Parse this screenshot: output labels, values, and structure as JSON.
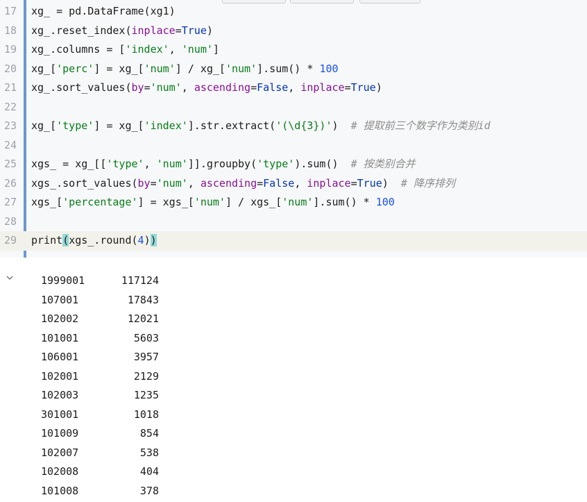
{
  "editor": {
    "lines": [
      {
        "num": "17",
        "tokens": [
          [
            "t",
            "xg_ = pd.DataFrame(xg1)"
          ]
        ]
      },
      {
        "num": "18",
        "tokens": [
          [
            "t",
            "xg_.reset_index("
          ],
          [
            "kw",
            "inplace"
          ],
          [
            "t",
            "="
          ],
          [
            "bool",
            "True"
          ],
          [
            "t",
            ")"
          ]
        ]
      },
      {
        "num": "19",
        "tokens": [
          [
            "t",
            "xg_.columns = ["
          ],
          [
            "str",
            "'index'"
          ],
          [
            "t",
            ", "
          ],
          [
            "str",
            "'num'"
          ],
          [
            "t",
            "]"
          ]
        ]
      },
      {
        "num": "20",
        "tokens": [
          [
            "t",
            "xg_["
          ],
          [
            "str",
            "'perc'"
          ],
          [
            "t",
            "] = xg_["
          ],
          [
            "str",
            "'num'"
          ],
          [
            "t",
            "] / xg_["
          ],
          [
            "str",
            "'num'"
          ],
          [
            "t",
            "].sum() * "
          ],
          [
            "num",
            "100"
          ]
        ]
      },
      {
        "num": "21",
        "tokens": [
          [
            "t",
            "xg_.sort_values("
          ],
          [
            "kw",
            "by"
          ],
          [
            "t",
            "="
          ],
          [
            "str",
            "'num'"
          ],
          [
            "t",
            ", "
          ],
          [
            "kw",
            "ascending"
          ],
          [
            "t",
            "="
          ],
          [
            "bool",
            "False"
          ],
          [
            "t",
            ", "
          ],
          [
            "kw",
            "inplace"
          ],
          [
            "t",
            "="
          ],
          [
            "bool",
            "True"
          ],
          [
            "t",
            ")"
          ]
        ]
      },
      {
        "num": "22",
        "tokens": []
      },
      {
        "num": "23",
        "tokens": [
          [
            "t",
            "xg_["
          ],
          [
            "str",
            "'type'"
          ],
          [
            "t",
            "] = xg_["
          ],
          [
            "str",
            "'index'"
          ],
          [
            "t",
            "].str.extract("
          ],
          [
            "str",
            "'(\\d{3})'"
          ],
          [
            "t",
            ")  "
          ],
          [
            "com",
            "# 提取前三个数字作为类别id"
          ]
        ]
      },
      {
        "num": "24",
        "tokens": []
      },
      {
        "num": "25",
        "tokens": [
          [
            "t",
            "xgs_ = xg_[["
          ],
          [
            "str",
            "'type'"
          ],
          [
            "t",
            ", "
          ],
          [
            "str",
            "'num'"
          ],
          [
            "t",
            "]].groupby("
          ],
          [
            "str",
            "'type'"
          ],
          [
            "t",
            ").sum()  "
          ],
          [
            "com",
            "# 按类别合并"
          ]
        ]
      },
      {
        "num": "26",
        "tokens": [
          [
            "t",
            "xgs_.sort_values("
          ],
          [
            "kw",
            "by"
          ],
          [
            "t",
            "="
          ],
          [
            "str",
            "'num'"
          ],
          [
            "t",
            ", "
          ],
          [
            "kw",
            "ascending"
          ],
          [
            "t",
            "="
          ],
          [
            "bool",
            "False"
          ],
          [
            "t",
            ", "
          ],
          [
            "kw",
            "inplace"
          ],
          [
            "t",
            "="
          ],
          [
            "bool",
            "True"
          ],
          [
            "t",
            ")  "
          ],
          [
            "com",
            "# 降序排列"
          ]
        ]
      },
      {
        "num": "27",
        "tokens": [
          [
            "t",
            "xgs_["
          ],
          [
            "str",
            "'percentage'"
          ],
          [
            "t",
            "] = xgs_["
          ],
          [
            "str",
            "'num'"
          ],
          [
            "t",
            "] / xgs_["
          ],
          [
            "str",
            "'num'"
          ],
          [
            "t",
            "].sum() * "
          ],
          [
            "num",
            "100"
          ]
        ]
      },
      {
        "num": "28",
        "tokens": []
      },
      {
        "num": "29",
        "tokens": [
          [
            "t",
            "print"
          ],
          [
            "hl",
            "("
          ],
          [
            "t",
            "xgs_.round("
          ],
          [
            "num",
            "4"
          ],
          [
            "t",
            ")"
          ],
          [
            "hl",
            ")"
          ]
        ],
        "current": true
      }
    ]
  },
  "output": {
    "collapse_icon": "chevron-down-icon",
    "rows": [
      [
        "1999001",
        "117124"
      ],
      [
        "107001",
        "17843"
      ],
      [
        "102002",
        "12021"
      ],
      [
        "101001",
        "5603"
      ],
      [
        "106001",
        "3957"
      ],
      [
        "102001",
        "2129"
      ],
      [
        "102003",
        "1235"
      ],
      [
        "301001",
        "1018"
      ],
      [
        "101009",
        "854"
      ],
      [
        "102007",
        "538"
      ],
      [
        "102008",
        "404"
      ],
      [
        "101008",
        "378"
      ]
    ]
  },
  "colors": {
    "gutter_bar": "#6b97d1",
    "string": "#067d17",
    "number": "#1750eb",
    "keyword_arg": "#871094",
    "boolean": "#0033b3",
    "comment": "#8c8c8c",
    "bracket_highlight": "#93d9d9"
  }
}
